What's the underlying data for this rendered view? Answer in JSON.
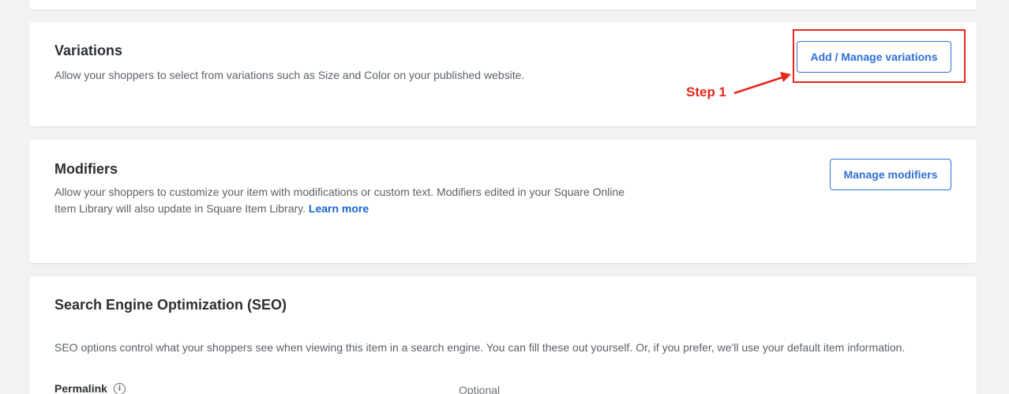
{
  "variations": {
    "title": "Variations",
    "description": "Allow your shoppers to select from variations such as Size and Color on your published website.",
    "button_label": "Add / Manage variations"
  },
  "annotation": {
    "step_label": "Step 1",
    "color": "#e8261a"
  },
  "modifiers": {
    "title": "Modifiers",
    "description": "Allow your shoppers to customize your item with modifications or custom text. Modifiers edited in your Square Online Item Library will also update in Square Item Library.",
    "learn_more": "Learn more",
    "button_label": "Manage modifiers"
  },
  "seo": {
    "title": "Search Engine Optimization (SEO)",
    "description": "SEO options control what your shoppers see when viewing this item in a search engine. You can fill these out yourself. Or, if you prefer, we'll use your default item information.",
    "permalink_label": "Permalink",
    "permalink_hint": "Optional",
    "info_icon": "info-icon"
  },
  "colors": {
    "accent": "#2f6fd6",
    "link": "#1a66d6",
    "background": "#f2f2f3"
  }
}
